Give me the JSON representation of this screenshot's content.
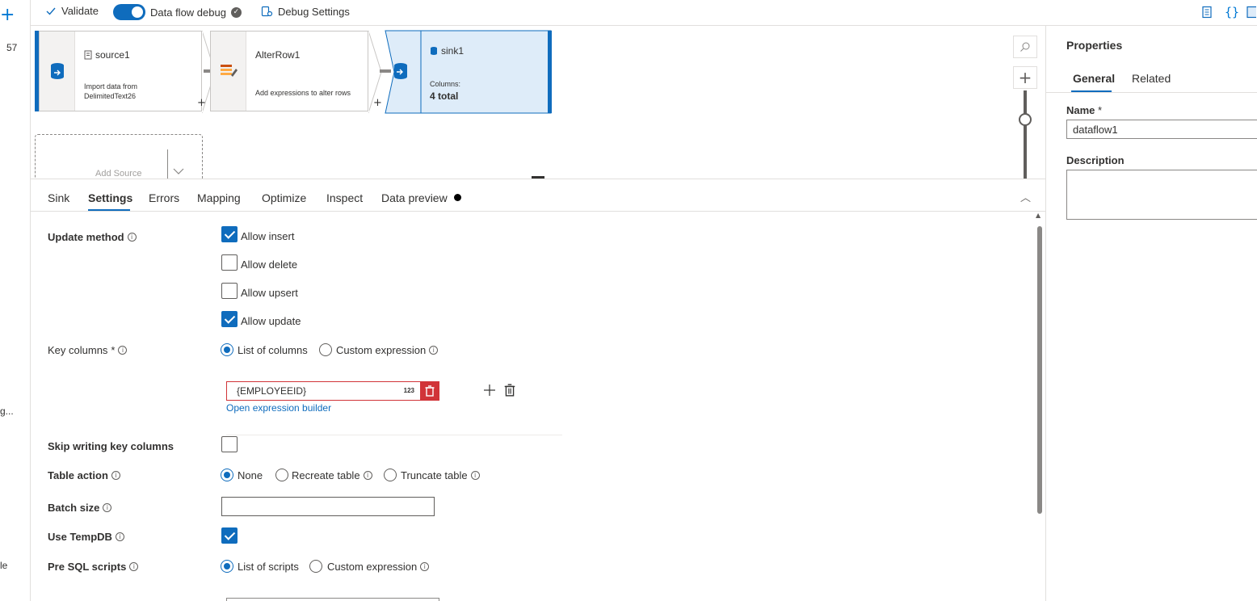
{
  "left_strip": {
    "count": "57",
    "item_a": "g...",
    "item_b": "le"
  },
  "toolbar": {
    "validate_label": "Validate",
    "debug_label": "Data flow debug",
    "debug_on": true,
    "debug_settings_label": "Debug Settings"
  },
  "canvas": {
    "nodes": [
      {
        "title": "source1",
        "desc_line1": "Import data from",
        "desc_line2": "DelimitedText26"
      },
      {
        "title": "AlterRow1",
        "desc": "Add expressions to alter rows"
      },
      {
        "title": "sink1",
        "desc_label": "Columns:",
        "desc_value": "4 total"
      }
    ],
    "add_source_label": "Add Source",
    "plus": "+"
  },
  "properties": {
    "title": "Properties",
    "tabs": [
      "General",
      "Related"
    ],
    "active_tab": "General",
    "name_label": "Name",
    "required_mark": "*",
    "name_value": "dataflow1",
    "description_label": "Description",
    "description_value": ""
  },
  "settings_tabs": {
    "items": [
      "Sink",
      "Settings",
      "Errors",
      "Mapping",
      "Optimize",
      "Inspect",
      "Data preview"
    ],
    "active": "Settings"
  },
  "settings": {
    "update_method": {
      "label": "Update method",
      "options": [
        {
          "label": "Allow insert",
          "checked": true
        },
        {
          "label": "Allow delete",
          "checked": false
        },
        {
          "label": "Allow upsert",
          "checked": false
        },
        {
          "label": "Allow update",
          "checked": true
        }
      ]
    },
    "key_columns": {
      "label": "Key columns",
      "required_mark": "*",
      "options": [
        "List of columns",
        "Custom expression"
      ],
      "selected": "List of columns",
      "expression_value": "{EMPLOYEEID}",
      "type_badge": "123",
      "link": "Open expression builder"
    },
    "skip_key_columns": {
      "label": "Skip writing key columns",
      "checked": false
    },
    "table_action": {
      "label": "Table action",
      "options": [
        "None",
        "Recreate table",
        "Truncate table"
      ],
      "selected": "None"
    },
    "batch_size": {
      "label": "Batch size",
      "value": ""
    },
    "use_tempdb": {
      "label": "Use TempDB",
      "checked": true
    },
    "pre_sql": {
      "label": "Pre SQL scripts",
      "options": [
        "List of scripts",
        "Custom expression"
      ],
      "selected": "List of scripts"
    }
  },
  "colors": {
    "accent": "#0f6cbd",
    "error": "#d13438"
  }
}
